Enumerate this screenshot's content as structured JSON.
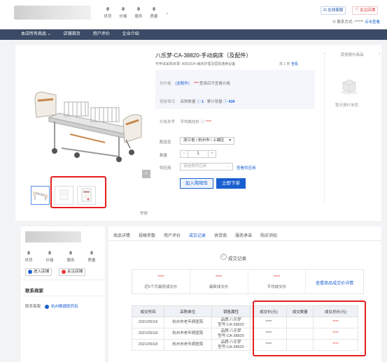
{
  "header": {
    "stats": [
      {
        "num": "0",
        "label": "供货"
      },
      {
        "num": "0",
        "label": "价格"
      },
      {
        "num": "0",
        "label": "服务"
      },
      {
        "num": "0",
        "label": "质量"
      }
    ],
    "online_service": "在线客服",
    "follow_store": "关注店铺",
    "contact_label": "联系方式:",
    "contact_value": "******",
    "contact_link": "点击查看"
  },
  "nav": [
    "本店所有商品",
    "店铺首页",
    "用户评价",
    "企业介绍"
  ],
  "product": {
    "title": "八乐梦-CA-38820-手动病床（及配件）",
    "subtitle": "可申请采购目录: A052024 病床护理及医院通用设备",
    "total": "共 1 件",
    "view": "查看",
    "score_label": "总价格",
    "score_link": "(含配件)",
    "stars": "****",
    "score_note": "登录后可查看价格",
    "sales_label": "销售情况",
    "sales_count_label": "采购数量",
    "sales_count": "1",
    "sales_total_label": "累计销量",
    "sales_total": "430",
    "ref_label": "价格参考",
    "ref_value": "平均成交价",
    "ref_stars": "****",
    "region_label": "配送至",
    "region_value": "浙江省 / 杭州市 / 上城区",
    "qty_label": "数量",
    "qty_value": "1",
    "supplier_label": "供应商",
    "supplier_placeholder": "请选择供应商",
    "supplier_link": "查看供应商",
    "cart_btn": "加入购物车",
    "buy_btn": "立即下单",
    "report": "举报",
    "side_title": "其他报价商品",
    "side_empty": "暂无报价信息"
  },
  "store": {
    "stats": [
      {
        "num": "0",
        "label": "供货"
      },
      {
        "num": "0",
        "label": "价格"
      },
      {
        "num": "0",
        "label": "服务"
      },
      {
        "num": "0",
        "label": "质量"
      }
    ],
    "enter": "进入店铺",
    "follow": "关注店铺",
    "contact_title": "联系商家",
    "contact_label": "联系客服",
    "contact_value": "杭州数据医药有"
  },
  "tabs": [
    "商品详情",
    "规格参数",
    "用户评价",
    "成交记录",
    "供货商",
    "服务承诺",
    "购买须知"
  ],
  "records": {
    "title": "成交记录",
    "stats": [
      {
        "value": "****",
        "label": "近6个月最低成交价"
      },
      {
        "value": "****",
        "label": "最新成交价"
      },
      {
        "value": "****",
        "label": "平均成交价"
      }
    ],
    "more_link": "查看商品成交价详情",
    "headers": [
      "成交时间",
      "采购单位",
      "销售属性",
      "成交价(元)",
      "成交数量",
      "成交总价(元)"
    ],
    "rows": [
      {
        "date": "2021/05/18",
        "buyer": "杭州市老年病医院",
        "attr1": "品牌:八乐梦",
        "attr2": "型号:CA-38820",
        "price": "****",
        "qty": "",
        "total": "****"
      },
      {
        "date": "2021/05/18",
        "buyer": "杭州市老年病医院",
        "attr1": "品牌:八乐梦",
        "attr2": "型号:CA-38820",
        "price": "****",
        "qty": "",
        "total": "****"
      },
      {
        "date": "2021/05/18",
        "buyer": "杭州市老年病医院",
        "attr1": "品牌:八乐梦",
        "attr2": "型号:CA-38820",
        "price": "****",
        "qty": "",
        "total": "****"
      }
    ]
  },
  "colors": {
    "accent": "#1a5fd0",
    "nav": "#3b4b66",
    "highlight": "#e61e1e",
    "price": "#e23c3c"
  }
}
